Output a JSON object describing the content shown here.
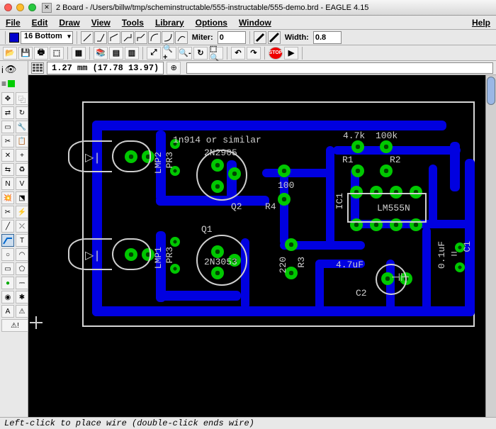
{
  "window": {
    "title": "2 Board - /Users/billw/tmp/scheminstructable/555-instructable/555-demo.brd - EAGLE 4.15"
  },
  "menu": {
    "items": [
      "File",
      "Edit",
      "Draw",
      "View",
      "Tools",
      "Library",
      "Options",
      "Window"
    ],
    "help": "Help"
  },
  "layer": {
    "value": "16 Bottom"
  },
  "miter": {
    "label": "Miter:",
    "value": "0"
  },
  "width": {
    "label": "Width:",
    "value": "0.8"
  },
  "coords": {
    "text": "1.27 mm (17.78 13.97)"
  },
  "silk": {
    "diode": "1n914 or similar",
    "fourpointseven_k": "4.7k",
    "hundred_k": "100k",
    "r1": "R1",
    "r2": "R2",
    "q2name": "2N2905",
    "q2": "Q2",
    "hundred": "100",
    "r4": "R4",
    "ic1": "IC1",
    "lm555n": "LM555N",
    "lmp2": "LMP2",
    "pr3a": "PR3",
    "q1": "Q1",
    "q1name": "2N3053",
    "lmp1": "LMP1",
    "pr3b": "PR3",
    "twotwenty": "220",
    "r3": "R3",
    "fourpointseven_uf": "4.7uF",
    "c2": "C2",
    "pointone_uf": "0.1uF",
    "c1": "C1"
  },
  "status": {
    "text": "Left-click to place wire (double-click ends wire)"
  }
}
